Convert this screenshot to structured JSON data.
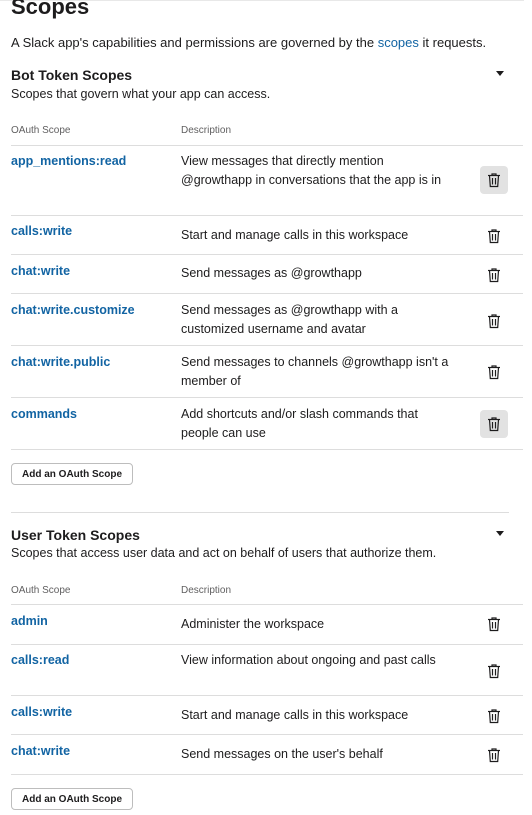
{
  "page": {
    "title": "Scopes",
    "intro_prefix": "A Slack app's capabilities and permissions are governed by the ",
    "intro_link": "scopes",
    "intro_suffix": " it requests."
  },
  "bot": {
    "title": "Bot Token Scopes",
    "subtitle": "Scopes that govern what your app can access.",
    "col_scope": "OAuth Scope",
    "col_desc": "Description",
    "rows": [
      {
        "scope": "app_mentions:read",
        "desc": "View messages that directly mention @growthapp in conversations that the app is in"
      },
      {
        "scope": "calls:write",
        "desc": "Start and manage calls in this workspace"
      },
      {
        "scope": "chat:write",
        "desc": "Send messages as @growthapp"
      },
      {
        "scope": "chat:write.customize",
        "desc": "Send messages as @growthapp with a customized username and avatar"
      },
      {
        "scope": "chat:write.public",
        "desc": "Send messages to channels @growthapp isn't a member of"
      },
      {
        "scope": "commands",
        "desc": "Add shortcuts and/or slash commands that people can use"
      }
    ],
    "add_button": "Add an OAuth Scope"
  },
  "user": {
    "title": "User Token Scopes",
    "subtitle": "Scopes that access user data and act on behalf of users that authorize them.",
    "col_scope": "OAuth Scope",
    "col_desc": "Description",
    "rows": [
      {
        "scope": "admin",
        "desc": "Administer the workspace"
      },
      {
        "scope": "calls:read",
        "desc": "View information about ongoing and past calls"
      },
      {
        "scope": "calls:write",
        "desc": "Start and manage calls in this workspace"
      },
      {
        "scope": "chat:write",
        "desc": "Send messages on the user's behalf"
      }
    ],
    "add_button": "Add an OAuth Scope"
  },
  "icons": {
    "trash": "trash-icon",
    "caret": "caret-down-icon"
  },
  "colors": {
    "link": "#1264a3",
    "text": "#1d1c1d",
    "muted": "#616061"
  }
}
